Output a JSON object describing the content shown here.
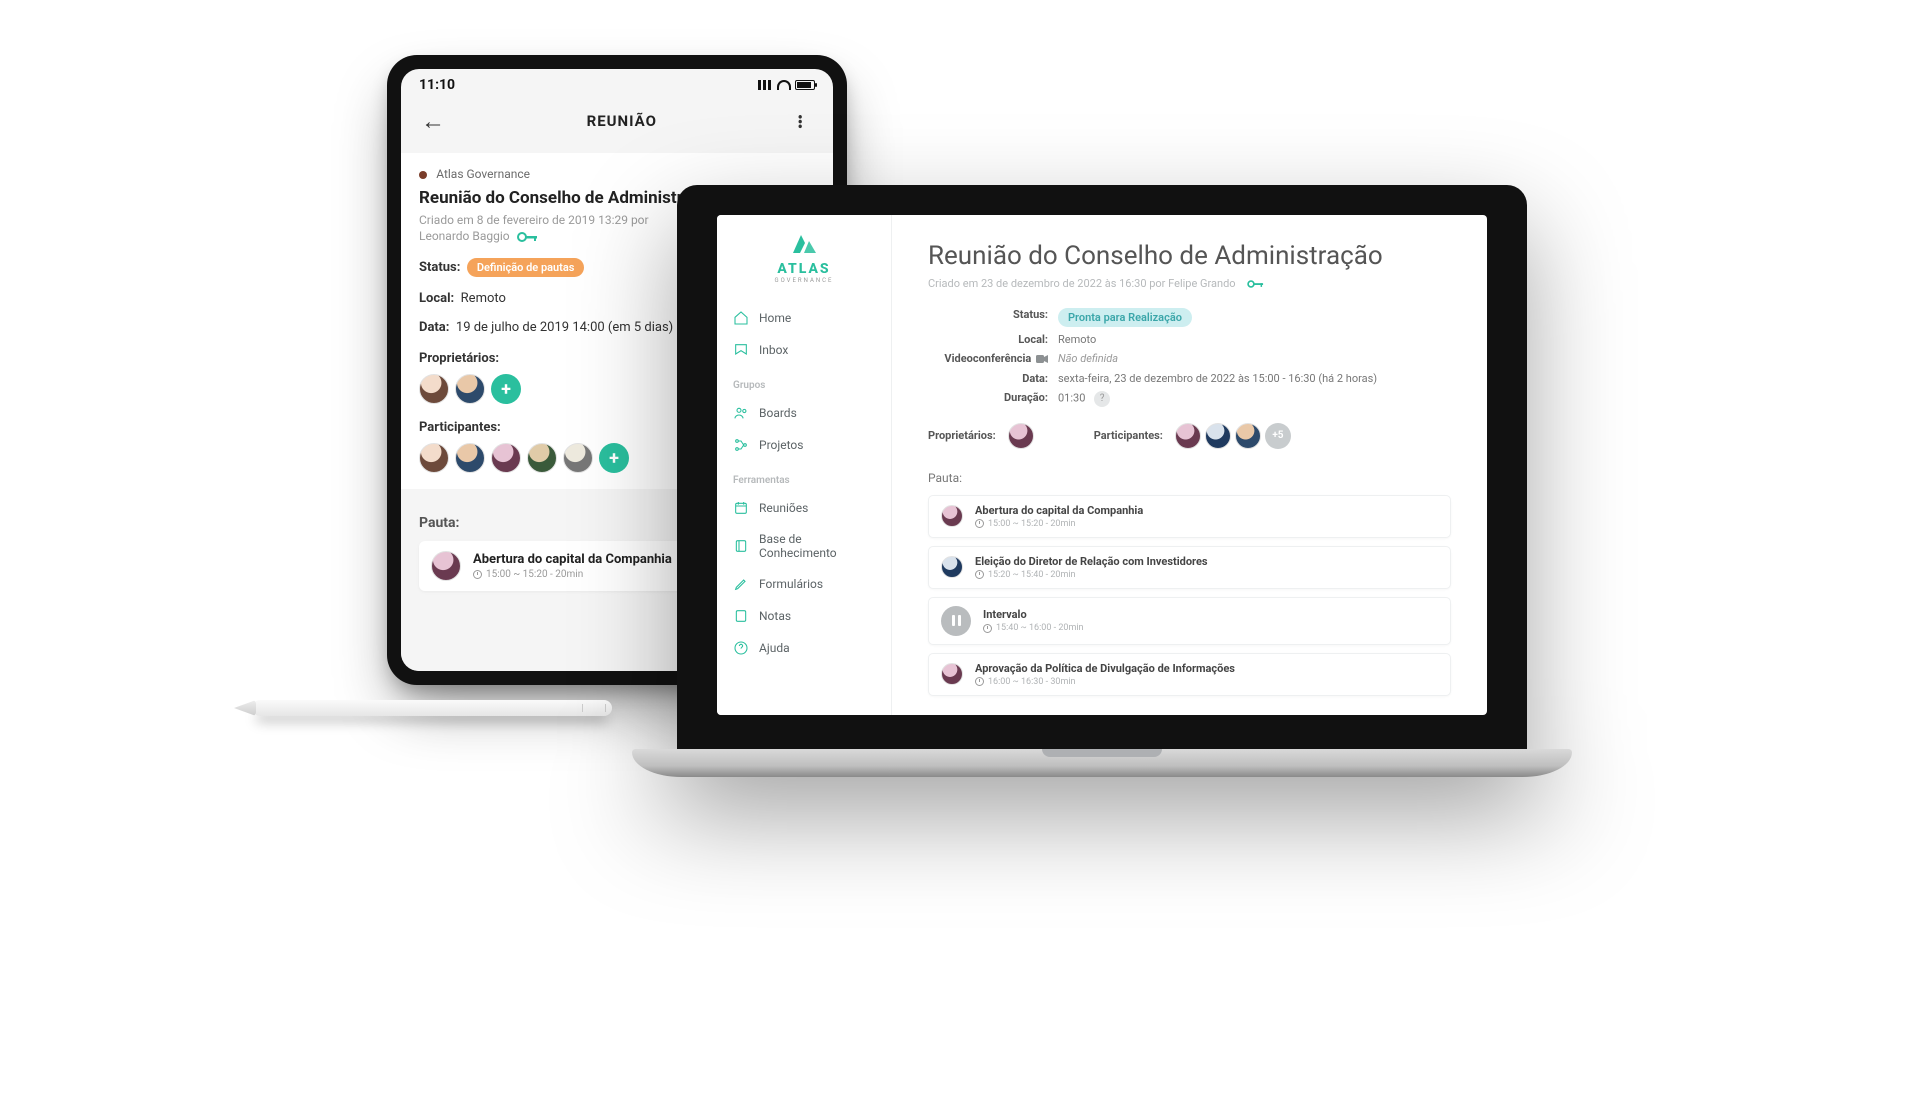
{
  "tablet": {
    "time": "11:10",
    "appbar_title": "REUNIÃO",
    "org": "Atlas Governance",
    "meeting_title": "Reunião do Conselho de Administração",
    "created_line1": "Criado em 8 de fevereiro de 2019 13:29 por",
    "created_line2": "Leonardo Baggio",
    "status_label": "Status:",
    "status_pill": "Definição de pautas",
    "local_label": "Local:",
    "local_value": "Remoto",
    "date_label": "Data:",
    "date_value": "19 de julho de 2019 14:00 (em 5 dias)",
    "owners_label": "Proprietários:",
    "participants_label": "Participantes:",
    "pauta_label": "Pauta:",
    "agenda": {
      "title": "Abertura do capital da Companhia",
      "time": "15:00 ~ 15:20 - 20min"
    }
  },
  "laptop": {
    "brand_word": "ATLAS",
    "brand_sub": "GOVERNANCE",
    "nav": {
      "home": "Home",
      "inbox": "Inbox",
      "grupos_label": "Grupos",
      "boards": "Boards",
      "projetos": "Projetos",
      "ferramentas_label": "Ferramentas",
      "reunioes": "Reuniões",
      "base": "Base de Conhecimento",
      "formularios": "Formulários",
      "notas": "Notas",
      "ajuda": "Ajuda"
    },
    "meeting_title": "Reunião do Conselho de Administração",
    "created": "Criado em 23 de dezembro de 2022 às 16:30 por Felipe Grando",
    "meta": {
      "status_label": "Status:",
      "status_pill": "Pronta para Realização",
      "local_label": "Local:",
      "local_value": "Remoto",
      "video_label": "Videoconferência",
      "video_value": "Não definida",
      "data_label": "Data:",
      "data_value": "sexta-feira, 23 de dezembro de 2022 às 15:00 - 16:30 (há 2 horas)",
      "dur_label": "Duração:",
      "dur_value": "01:30"
    },
    "owners_label": "Proprietários:",
    "participants_label": "Participantes:",
    "more_count": "+5",
    "pauta_label": "Pauta:",
    "agenda": [
      {
        "title": "Abertura do capital da Companhia",
        "time": "15:00 ~ 15:20 - 20min"
      },
      {
        "title": "Eleição do Diretor de Relação com Investidores",
        "time": "15:20 ~ 15:40 - 20min"
      },
      {
        "title": "Intervalo",
        "time": "15:40 ~ 16:00 - 20min"
      },
      {
        "title": "Aprovação da Política de Divulgação de Informações",
        "time": "16:00 ~ 16:30 - 30min"
      }
    ]
  }
}
